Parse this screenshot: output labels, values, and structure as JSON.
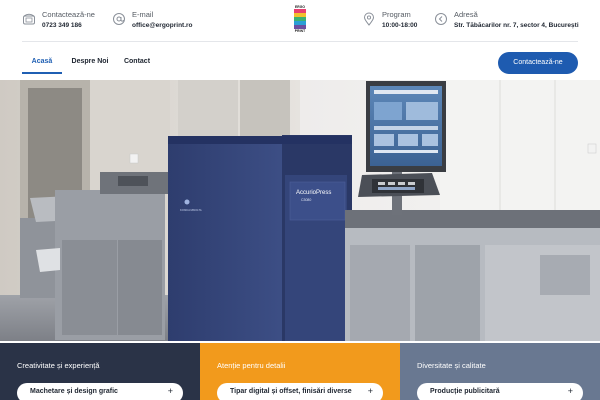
{
  "contacts": {
    "phone": {
      "label": "Contactează-ne",
      "value": "0723 349 186",
      "icon": "phone-icon"
    },
    "email": {
      "label": "E-mail",
      "value": "office@ergoprint.ro",
      "icon": "at-icon"
    },
    "program": {
      "label": "Program",
      "value": "10:00-18:00",
      "icon": "location-pin-icon"
    },
    "address": {
      "label": "Adresă",
      "value": "Str. Tăbăcarilor nr. 7, sector 4, București",
      "icon": "back-arrow-icon"
    }
  },
  "logo": {
    "top_word": "ERGO",
    "bottom_word": "PRINT",
    "stripe_colors": [
      "#e83f6f",
      "#f2c12e",
      "#3bb273",
      "#2a9fd6",
      "#6b4fa0"
    ]
  },
  "nav": {
    "items": [
      {
        "label": "Acasă",
        "active": true
      },
      {
        "label": "Despre Noi",
        "active": false
      },
      {
        "label": "Contact",
        "active": false
      }
    ],
    "cta_label": "Contactează-ne"
  },
  "panels": [
    {
      "title": "Creativitate și experiență",
      "button": "Machetare și design grafic",
      "color": "#2a3347"
    },
    {
      "title": "Atenție pentru detalii",
      "button": "Tipar digital și offset, finisări diverse",
      "color": "#f29a1c"
    },
    {
      "title": "Diversitate și calitate",
      "button": "Producție publicitară",
      "color": "#697891"
    }
  ],
  "colors": {
    "accent": "#1f5fb3",
    "cta": "#1e5bb0"
  }
}
